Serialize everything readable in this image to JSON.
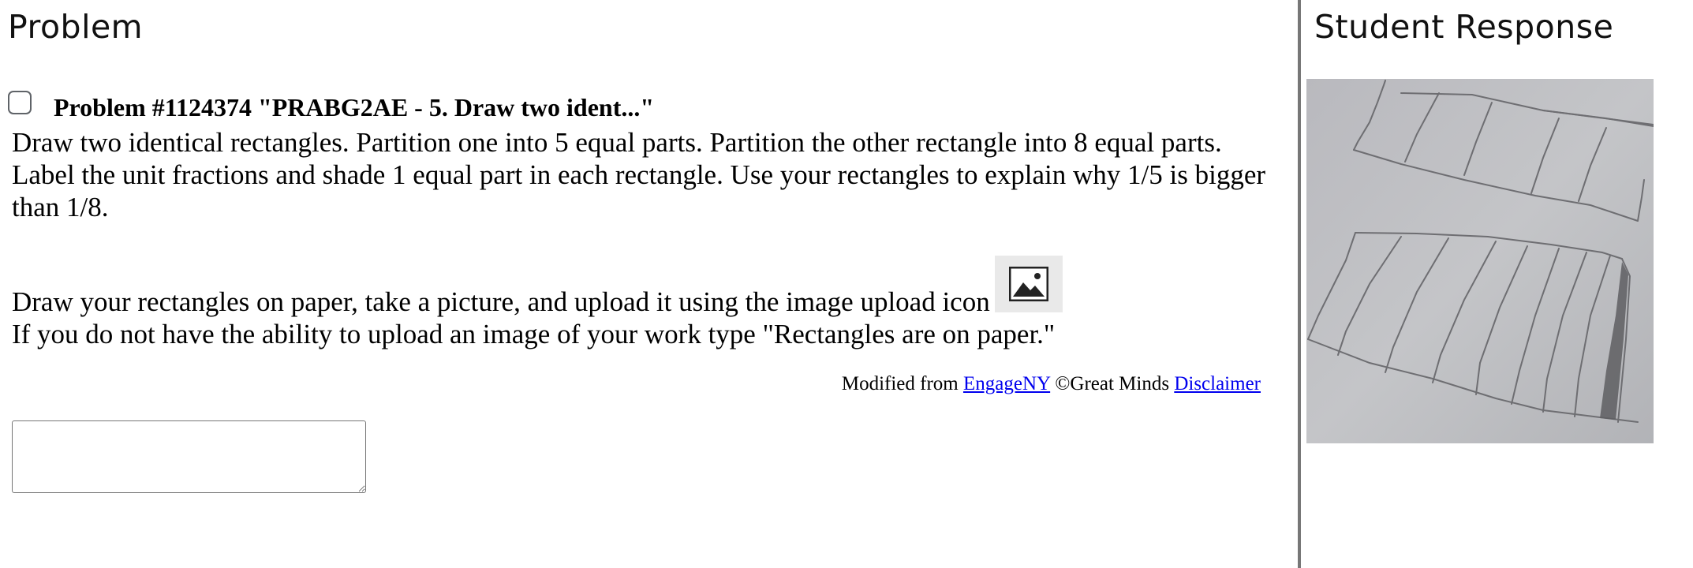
{
  "problem": {
    "heading": "Problem",
    "title": "Problem #1124374 \"PRABG2AE - 5. Draw two ident...\"",
    "paragraph_1": "Draw two identical rectangles. Partition one into 5 equal parts. Partition the other rectangle into 8 equal parts. Label the unit fractions and shade 1 equal part in each rectangle. Use your rectangles to explain why 1/5 is bigger than 1/8.",
    "paragraph_2": "Draw your rectangles on paper, take a picture, and upload it using the image upload icon",
    "paragraph_3": "If you do not have the ability to upload an image of your work type \"Rectangles are on paper.\"",
    "image_icon": "image-upload-icon",
    "attribution": {
      "prefix": "Modified from",
      "link_1": "EngageNY",
      "middle": "©Great Minds",
      "link_2": "Disclaimer"
    },
    "answer_value": ""
  },
  "response": {
    "heading": "Student Response"
  },
  "colors": {
    "link": "#0000ee",
    "divider": "#777777",
    "photo_background": "#bfc0c3",
    "pencil": "#6e6e72"
  }
}
